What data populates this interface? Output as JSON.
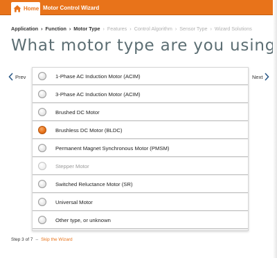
{
  "topbar": {
    "home_label": "Home",
    "wizard_title": "Motor Control Wizard",
    "accent_color": "#e8731a"
  },
  "breadcrumb": {
    "items": [
      {
        "label": "Application",
        "state": "done"
      },
      {
        "label": "Function",
        "state": "done"
      },
      {
        "label": "Motor Type",
        "state": "current"
      },
      {
        "label": "Features",
        "state": "pending"
      },
      {
        "label": "Control Algorithm",
        "state": "pending"
      },
      {
        "label": "Sensor Type",
        "state": "pending"
      },
      {
        "label": "Wizard Solutions",
        "state": "pending"
      }
    ],
    "separator": "›"
  },
  "heading": "What motor type are you using?",
  "nav": {
    "prev_label": "Prev",
    "next_label": "Next"
  },
  "options": [
    {
      "label": "1-Phase AC Induction Motor (ACIM)",
      "selected": false,
      "disabled": false
    },
    {
      "label": "3-Phase AC Induction Motor (ACIM)",
      "selected": false,
      "disabled": false
    },
    {
      "label": "Brushed DC Motor",
      "selected": false,
      "disabled": false
    },
    {
      "label": "Brushless DC Motor (BLDC)",
      "selected": true,
      "disabled": false
    },
    {
      "label": "Permanent Magnet Synchronous Motor (PMSM)",
      "selected": false,
      "disabled": false
    },
    {
      "label": "Stepper Motor",
      "selected": false,
      "disabled": true
    },
    {
      "label": "Switched Reluctance Motor (SR)",
      "selected": false,
      "disabled": false
    },
    {
      "label": "Universal Motor",
      "selected": false,
      "disabled": false
    },
    {
      "label": "Other type, or unknown",
      "selected": false,
      "disabled": false
    }
  ],
  "footer": {
    "step_text": "Step 3 of 7",
    "dash": "–",
    "skip_label": "Skip the Wizard"
  }
}
